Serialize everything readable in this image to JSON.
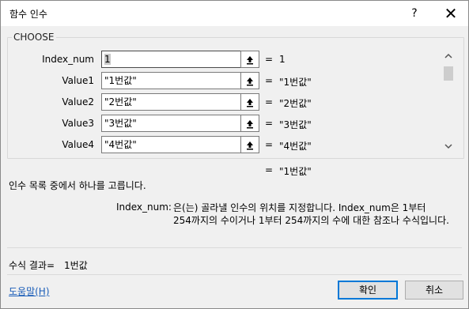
{
  "dialog": {
    "title": "함수 인수",
    "help_symbol": "?",
    "close_symbol": "✕"
  },
  "function_name": "CHOOSE",
  "arguments": [
    {
      "label": "Index_num",
      "value": "1",
      "result": "1"
    },
    {
      "label": "Value1",
      "value": "\"1번값\"",
      "result": "\"1번값\""
    },
    {
      "label": "Value2",
      "value": "\"2번값\"",
      "result": "\"2번값\""
    },
    {
      "label": "Value3",
      "value": "\"3번값\"",
      "result": "\"3번값\""
    },
    {
      "label": "Value4",
      "value": "\"4번값\"",
      "result": "\"4번값\""
    }
  ],
  "ref_button_icon": "collapse-dialog-icon",
  "equals_sign": "=",
  "function_result": "\"1번값\"",
  "function_description": "인수 목록 중에서 하나를 고릅니다.",
  "argument_description": {
    "name": "Index_num:",
    "line1": "은(는) 골라낼 인수의 위치를 지정합니다. Index_num은 1부터",
    "line2": "254까지의 수이거나 1부터 254까지의 수에 대한 참조나 수식입니다."
  },
  "formula_result": {
    "label": "수식 결과=",
    "value": "1번값"
  },
  "help_link": "도움말(H)",
  "buttons": {
    "ok": "확인",
    "cancel": "취소"
  }
}
